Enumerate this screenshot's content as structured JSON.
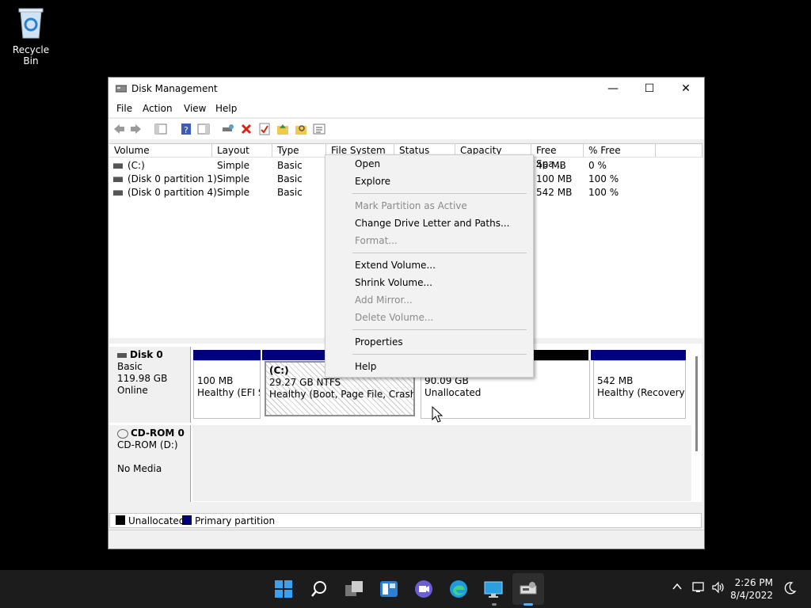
{
  "desktop": {
    "recycle_bin_label": "Recycle Bin"
  },
  "window": {
    "title": "Disk Management",
    "controls": {
      "minimize": "—",
      "maximize": "☐",
      "close": "✕"
    }
  },
  "menubar": [
    "File",
    "Action",
    "View",
    "Help"
  ],
  "volume_list": {
    "columns": [
      "Volume",
      "Layout",
      "Type",
      "File System",
      "Status",
      "Capacity",
      "Free Spa...",
      "% Free"
    ],
    "rows": [
      {
        "volume": "(C:)",
        "layout": "Simple",
        "type": "Basic",
        "free": "46 MB",
        "pct": "0 %"
      },
      {
        "volume": "(Disk 0 partition 1)",
        "layout": "Simple",
        "type": "Basic",
        "free": "100 MB",
        "pct": "100 %"
      },
      {
        "volume": "(Disk 0 partition 4)",
        "layout": "Simple",
        "type": "Basic",
        "free": "542 MB",
        "pct": "100 %"
      }
    ]
  },
  "disks": [
    {
      "name": "Disk 0",
      "kind": "Basic",
      "size": "119.98 GB",
      "state": "Online",
      "partitions": [
        {
          "line1": "",
          "line2": "100 MB",
          "line3": "Healthy (EFI S"
        },
        {
          "line1": "(C:)",
          "line2": "29.27 GB NTFS",
          "line3": "Healthy (Boot, Page File, Crash Du"
        },
        {
          "line1": "",
          "line2": "90.09 GB",
          "line3": "Unallocated"
        },
        {
          "line1": "",
          "line2": "542 MB",
          "line3": "Healthy (Recovery P"
        }
      ]
    },
    {
      "name": "CD-ROM 0",
      "kind": "CD-ROM (D:)",
      "size": "",
      "state": "No Media"
    }
  ],
  "legend": {
    "unallocated": "Unallocated",
    "primary": "Primary partition",
    "unallocated_color": "#000000",
    "primary_color": "#00007f"
  },
  "context_menu": {
    "open": "Open",
    "explore": "Explore",
    "mark_active": "Mark Partition as Active",
    "change_letter": "Change Drive Letter and Paths...",
    "format": "Format...",
    "extend": "Extend Volume...",
    "shrink": "Shrink Volume...",
    "add_mirror": "Add Mirror...",
    "delete": "Delete Volume...",
    "properties": "Properties",
    "help": "Help"
  },
  "taskbar": {
    "time": "2:26 PM",
    "date": "8/4/2022",
    "icons": [
      "windows-start-icon",
      "search-icon",
      "task-view-icon",
      "widgets-icon",
      "chat-icon",
      "edge-icon",
      "remote-desktop-icon",
      "disk-management-icon"
    ]
  }
}
